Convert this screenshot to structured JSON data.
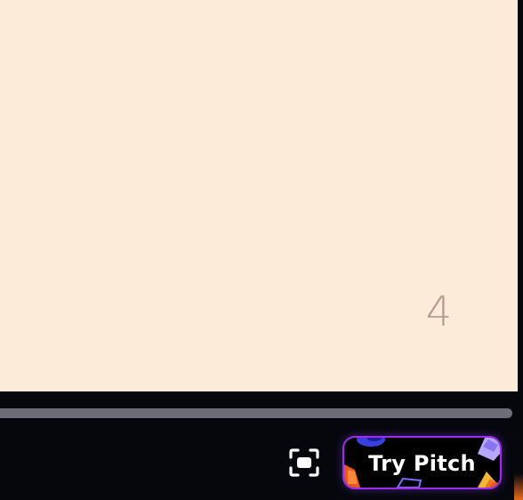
{
  "slide": {
    "page_number": "4",
    "background_color": "#fdebd9",
    "page_number_color": "#b89a91"
  },
  "scrollbar": {
    "thumb_color": "#6b6e74"
  },
  "controls": {
    "fullscreen_icon": "fullscreen-icon",
    "try_pitch_label": "Try Pitch",
    "try_pitch_border_color": "#9d2cf0"
  }
}
